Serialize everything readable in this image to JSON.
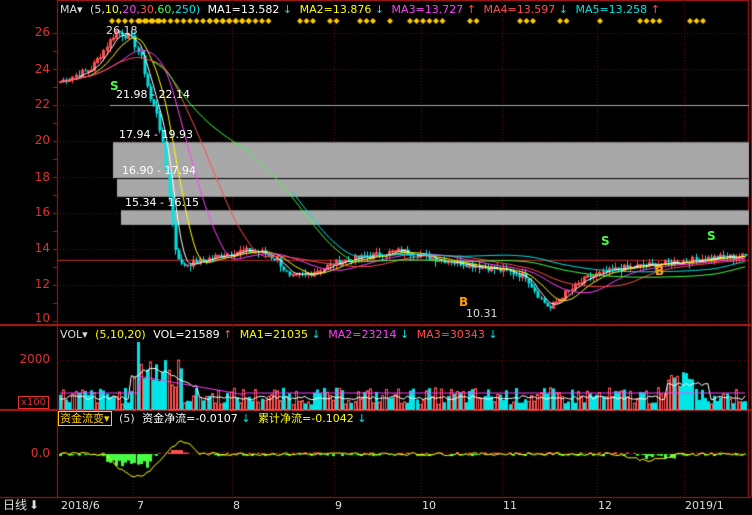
{
  "colors": {
    "bg": "#000000",
    "axis": "#b01818",
    "grid": "#6b0f0f",
    "up": "#ff5050",
    "down": "#00e5e5",
    "white": "#ffffff",
    "yellow": "#ffff00",
    "magenta": "#ff40ff",
    "green": "#44ff44",
    "zone": "#a8a8a8",
    "text": "#dddddd"
  },
  "price_panel": {
    "indicator_name": "MA",
    "params_open": "(5,",
    "p5": "10,",
    "p10": "20,",
    "p20": "30,",
    "p30": "60,",
    "p60": "250)",
    "ma1": "MA1=13.582",
    "ma2": "MA2=13.876",
    "ma3": "MA3=13.727",
    "ma4": "MA4=13.597",
    "ma5": "MA5=13.258",
    "y_ticks": [
      "26",
      "24",
      "22",
      "20",
      "18",
      "16",
      "14",
      "12",
      "10"
    ],
    "high_label": "26.18",
    "low_label": "10.31",
    "zones": [
      {
        "label": "21.98 - 22.14"
      },
      {
        "label": "17.94 - 19.93"
      },
      {
        "label": "16.90 - 17.94"
      },
      {
        "label": "15.34 - 16.15"
      }
    ],
    "signal_s": "S",
    "signal_b": "B"
  },
  "vol_panel": {
    "indicator_name": "VOL",
    "params": "(5,10,20)",
    "vol": "VOL=21589",
    "ma1": "MA1=21035",
    "ma2": "MA2=23214",
    "ma3": "MA3=30343",
    "y_tick": "2000",
    "unit": "x100"
  },
  "flow_panel": {
    "indicator_name": "资金流变",
    "params": "(5)",
    "net": "资金净流=-0.0107",
    "cum": "累计净流=-0.1042",
    "y_tick": "0.0"
  },
  "x_axis": {
    "period": "日线",
    "ticks": [
      "2018/6",
      "7",
      "8",
      "9",
      "10",
      "11",
      "12",
      "2019/1"
    ]
  }
}
